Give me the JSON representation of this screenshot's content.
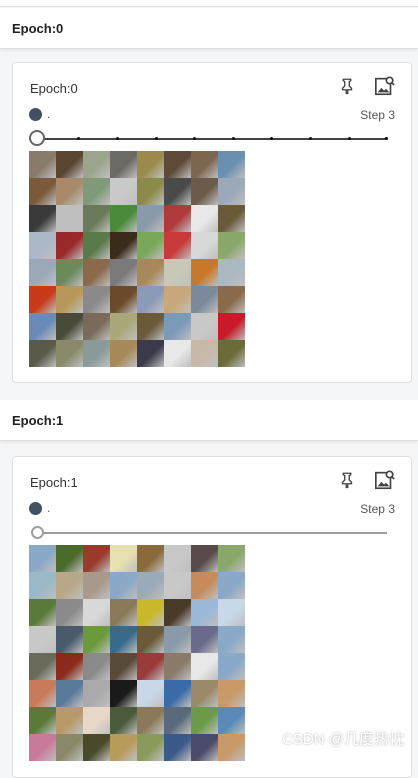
{
  "sections": [
    {
      "header": "Epoch:0",
      "card": {
        "title": "Epoch:0",
        "run_label": ".",
        "step_label": "Step 3",
        "step_position": 0.0
      }
    },
    {
      "header": "Epoch:1",
      "card": {
        "title": "Epoch:1",
        "run_label": ".",
        "step_label": "Step 3",
        "step_position": 0.0
      }
    }
  ],
  "icons": {
    "pin": "pin-icon",
    "image_search": "image-search-icon",
    "run_color": "#425066"
  },
  "watermark": "CSDN @几度热忱",
  "image_grid": {
    "rows": 8,
    "cols": 8,
    "palette_epoch0": [
      "#8a7a6a",
      "#5b4632",
      "#9aa58c",
      "#6e6a66",
      "#9c8a4c",
      "#5f4a3a",
      "#7d6650",
      "#6a8fb0",
      "#7a5a3a",
      "#a88a6a",
      "#7f9a7a",
      "#c9c9c9",
      "#8c8a4a",
      "#4a4a4a",
      "#6c5a4a",
      "#9aa8b8",
      "#3a3a3a",
      "#bfbfbf",
      "#6a7a5a",
      "#4a8a3a",
      "#8a9aaa",
      "#b03a3a",
      "#e8e8e8",
      "#6a5a3a",
      "#aab8c8",
      "#9a2a2a",
      "#5a7a4a",
      "#3a2a1a",
      "#7aa85a",
      "#c83a3a",
      "#d8d8d8",
      "#8aa86a",
      "#9aa8b8",
      "#6a8a5a",
      "#8a6a4a",
      "#7a7a7a",
      "#a8885a",
      "#c8c8b8",
      "#c8782a",
      "#aab8c0",
      "#c83a1a",
      "#b8985a",
      "#8a8a8a",
      "#6a4a2a",
      "#8a9ab8",
      "#c8a87a",
      "#7a8a9a",
      "#8a6a4a",
      "#6a8ab8",
      "#4a4a3a",
      "#7a6a5a",
      "#a8a87a",
      "#6a5a3a",
      "#7a9ab8",
      "#c8c8c8",
      "#c81a2a",
      "#5a5a4a",
      "#8a8a6a",
      "#8a9a9a",
      "#a88a5a",
      "#3a3a4a",
      "#e8e8e8",
      "#c8b8a8",
      "#6a6a3a"
    ],
    "palette_epoch1": [
      "#8aa8c8",
      "#4a6a2a",
      "#9a3a2a",
      "#e8e0b0",
      "#8a6a3a",
      "#c8c8c8",
      "#5a4a4a",
      "#8aa86a",
      "#9ab8c8",
      "#b8a88a",
      "#a89a8a",
      "#8aa8c8",
      "#9aaab8",
      "#c8c8c8",
      "#c88a5a",
      "#8aa8c8",
      "#5a7a3a",
      "#8a8a8a",
      "#d8d8d8",
      "#8a7a5a",
      "#c8b82a",
      "#4a3a2a",
      "#9ab8d8",
      "#c8d8e8",
      "#c8c8c8",
      "#4a5a6a",
      "#6a9a3a",
      "#3a6a8a",
      "#6a5a3a",
      "#8a9aaa",
      "#6a6a8a",
      "#8aa8c8",
      "#6a6a5a",
      "#8a2a1a",
      "#8a8a8a",
      "#5a4a3a",
      "#9a3a3a",
      "#8a7a6a",
      "#e8e8e8",
      "#8aa8c8",
      "#c87a5a",
      "#5a7a9a",
      "#aaaaaa",
      "#1a1a1a",
      "#c8d8e8",
      "#3a6aa8",
      "#9a8a6a",
      "#c89a6a",
      "#5a7a3a",
      "#b89a6a",
      "#e8d8c8",
      "#4a5a3a",
      "#8a7a5a",
      "#5a6a7a",
      "#6a9a4a",
      "#5a8ab8",
      "#c87a9a",
      "#8a8a6a",
      "#4a4a2a",
      "#b89a5a",
      "#8a9a5a",
      "#3a5a8a",
      "#4a4a6a",
      "#c89a6a"
    ]
  }
}
